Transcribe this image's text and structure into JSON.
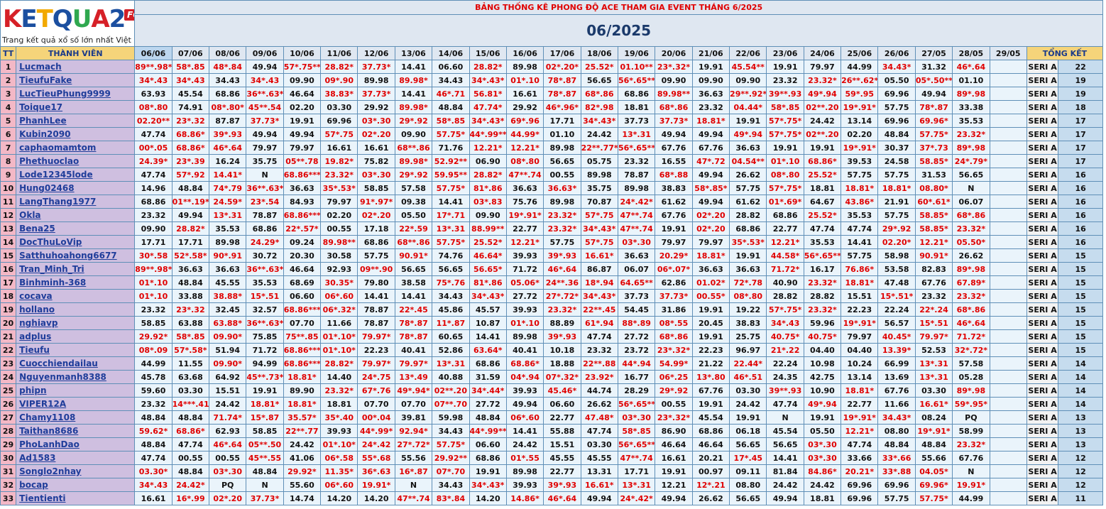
{
  "logo": {
    "word": "KETQUA2",
    "badge": "FORUM",
    "tagline": "Trang kết quả xổ số lớn nhất Việt Nam",
    "letters": [
      "K",
      "E",
      "T",
      "Q",
      "U",
      "A",
      "2"
    ],
    "letter_colors": [
      "#d62027",
      "#1b4fa0",
      "#f2a900",
      "#1b4fa0",
      "#2fa84f",
      "#d62027",
      "#1b4fa0"
    ]
  },
  "title": "BẢNG THỐNG KÊ PHONG ĐỘ ACE THAM GIA EVENT THÁNG 6/2025",
  "month": "06/2025",
  "headers": {
    "tt": "TT",
    "name": "THÀNH VIÊN",
    "total": "TỔNG KẾT",
    "dates": [
      "06/06",
      "07/06",
      "08/06",
      "09/06",
      "10/06",
      "11/06",
      "12/06",
      "13/06",
      "14/06",
      "15/06",
      "16/06",
      "17/06",
      "18/06",
      "19/06",
      "20/06",
      "21/06",
      "22/06",
      "23/06",
      "24/06",
      "25/06",
      "26/06",
      "27/05",
      "28/05",
      "29/05"
    ]
  },
  "rows": [
    {
      "tt": "1",
      "name": "Lucmach",
      "vals": [
        "89**.98*",
        "58*.85",
        "48*.84",
        "49.94",
        "57*.75**",
        "28.82*",
        "37.73*",
        "14.41",
        "06.60",
        "28.82*",
        "89.98",
        "02*.20*",
        "25.52*",
        "01.10**",
        "23*.32*",
        "19.91",
        "45.54**",
        "19.91",
        "79.97",
        "44.99",
        "34.43*",
        "31.32",
        "46*.64",
        ""
      ],
      "seri": "SERI A",
      "score": "22"
    },
    {
      "tt": "2",
      "name": "TieufuFake",
      "vals": [
        "34*.43",
        "34*.43",
        "34.43",
        "34*.43",
        "09.90",
        "09*.90",
        "89.98",
        "89.98*",
        "34.43",
        "34*.43*",
        "01*.10",
        "78*.87",
        "56.65",
        "56*.65**",
        "09.90",
        "09.90",
        "09.90",
        "23.32",
        "23.32*",
        "26**.62*",
        "05.50",
        "05*.50**",
        "01.10",
        ""
      ],
      "seri": "SERI A",
      "score": "19"
    },
    {
      "tt": "3",
      "name": "LucTieuPhung9999",
      "vals": [
        "63.93",
        "45.54",
        "68.86",
        "36**.63*",
        "46.64",
        "38.83*",
        "37.73*",
        "14.41",
        "46*.71",
        "56.81*",
        "16.61",
        "78*.87",
        "68*.86",
        "68.86",
        "89.98**",
        "36.63",
        "29**.92*",
        "39**.93",
        "49*.94",
        "59*.95",
        "69.96",
        "49.94",
        "89*.98",
        ""
      ],
      "seri": "SERI A",
      "score": "19"
    },
    {
      "tt": "4",
      "name": "Toique17",
      "vals": [
        "08*.80",
        "74.91",
        "08*.80*",
        "45**.54",
        "02.20",
        "03.30",
        "29.92",
        "89.98*",
        "48.84",
        "47.74*",
        "29.92",
        "46*.96*",
        "82*.98",
        "18.81",
        "68*.86",
        "23.32",
        "04.44*",
        "58*.85",
        "02**.20",
        "19*.91*",
        "57.75",
        "78*.87",
        "33.38",
        ""
      ],
      "seri": "SERI A",
      "score": "18"
    },
    {
      "tt": "5",
      "name": "PhanhLee",
      "vals": [
        "02.20**",
        "23*.32",
        "87.87",
        "37.73*",
        "19.91",
        "69.96",
        "03*.30",
        "29*.92",
        "58*.85",
        "34*.43*",
        "69*.96",
        "17.71",
        "34*.43*",
        "37.73",
        "37.73*",
        "18.81*",
        "19.91",
        "57*.75*",
        "24.42",
        "13.14",
        "69.96",
        "69.96*",
        "35.53",
        ""
      ],
      "seri": "SERI A",
      "score": "17"
    },
    {
      "tt": "6",
      "name": "Kubin2090",
      "vals": [
        "47.74",
        "68.86*",
        "39*.93",
        "49.94",
        "49.94",
        "57*.75",
        "02*.20",
        "09.90",
        "57.75*",
        "44*.99**",
        "44.99*",
        "01.10",
        "24.42",
        "13*.31",
        "49.94",
        "49.94",
        "49*.94",
        "57*.75*",
        "02**.20",
        "02.20",
        "48.84",
        "57.75*",
        "23.32*",
        ""
      ],
      "seri": "SERI A",
      "score": "17"
    },
    {
      "tt": "7",
      "name": "caphaomamtom",
      "vals": [
        "00*.05",
        "68.86*",
        "46*.64",
        "79.97",
        "79.97",
        "16.61",
        "16.61",
        "68**.86",
        "71.76",
        "12.21*",
        "12.21*",
        "89.98",
        "22**.77*",
        "56*.65**",
        "67.76",
        "67.76",
        "36.63",
        "19.91",
        "19.91",
        "19*.91*",
        "30.37",
        "37*.73",
        "89*.98",
        ""
      ],
      "seri": "SERI A",
      "score": "17"
    },
    {
      "tt": "8",
      "name": "Phethuoclao",
      "vals": [
        "24.39*",
        "23*.39",
        "16.24",
        "35.75",
        "05**.78",
        "19.82*",
        "75.82",
        "89.98*",
        "52.92**",
        "06.90",
        "08*.80",
        "56.65",
        "05.75",
        "23.32",
        "16.55",
        "47*.72",
        "04.54**",
        "01*.10",
        "68.86*",
        "39.53",
        "24.58",
        "58.85*",
        "24*.79*",
        ""
      ],
      "seri": "SERI A",
      "score": "17"
    },
    {
      "tt": "9",
      "name": "Lode12345lode",
      "vals": [
        "47.74",
        "57*.92",
        "14.41*",
        "N",
        "68.86***",
        "23.32*",
        "03*.30",
        "29*.92",
        "59.95**",
        "28.82*",
        "47**.74",
        "00.55",
        "89.98",
        "78.87",
        "68*.88",
        "49.94",
        "26.62",
        "08*.80",
        "25.52*",
        "57.75",
        "57.75",
        "31.53",
        "56.65",
        ""
      ],
      "seri": "SERI A",
      "score": "16"
    },
    {
      "tt": "10",
      "name": "Hung02468",
      "vals": [
        "14.96",
        "48.84",
        "74*.79",
        "36**.63*",
        "36.63",
        "35*.53*",
        "58.85",
        "57.58",
        "57.75*",
        "81*.86",
        "36.63",
        "36.63*",
        "35.75",
        "89.98",
        "38.83",
        "58*.85*",
        "57.75",
        "57*.75*",
        "18.81",
        "18.81*",
        "18.81*",
        "08.80*",
        "N",
        ""
      ],
      "seri": "SERI A",
      "score": "16"
    },
    {
      "tt": "11",
      "name": "LangThang1977",
      "vals": [
        "68.86",
        "01**.19**",
        "24.59*",
        "23*.54",
        "84.93",
        "79.97",
        "91*.97*",
        "09.38",
        "14.41",
        "03*.83",
        "75.76",
        "89.98",
        "70.87",
        "24*.42*",
        "61.62",
        "49.94",
        "61.62",
        "01*.69*",
        "64.67",
        "43.86*",
        "21.91",
        "60*.61*",
        "06.07",
        ""
      ],
      "seri": "SERI A",
      "score": "16"
    },
    {
      "tt": "12",
      "name": "Okla",
      "vals": [
        "23.32",
        "49.94",
        "13*.31",
        "78.87",
        "68.86***",
        "02.20",
        "02*.20",
        "05.50",
        "17*.71",
        "09.90",
        "19*.91*",
        "23.32*",
        "57*.75",
        "47**.74",
        "67.76",
        "02*.20",
        "28.82",
        "68.86",
        "25.52*",
        "35.53",
        "57.75",
        "58.85*",
        "68*.86",
        ""
      ],
      "seri": "SERI A",
      "score": "16"
    },
    {
      "tt": "13",
      "name": "Bena25",
      "vals": [
        "09.90",
        "28.82*",
        "35.53",
        "68.86",
        "22*.57*",
        "00.55",
        "17.18",
        "22*.59",
        "13*.31",
        "88.99**",
        "22.77",
        "23.32*",
        "34*.43*",
        "47**.74",
        "19.91",
        "02*.20",
        "68.86",
        "22.77",
        "47.74",
        "47.74",
        "29*.92",
        "58.85*",
        "23.32*",
        ""
      ],
      "seri": "SERI A",
      "score": "16"
    },
    {
      "tt": "14",
      "name": "DocThuLoVip",
      "vals": [
        "17.71",
        "17.71",
        "89.98",
        "24.29*",
        "09.24",
        "89.98**",
        "68.86",
        "68**.86",
        "57.75*",
        "25.52*",
        "12.21*",
        "57.75",
        "57*.75",
        "03*.30",
        "79.97",
        "79.97",
        "35*.53*",
        "12.21*",
        "35.53",
        "14.41",
        "02.20*",
        "12.21*",
        "05.50*",
        ""
      ],
      "seri": "SERI A",
      "score": "16"
    },
    {
      "tt": "15",
      "name": "Satthuhoahong6677",
      "vals": [
        "30*.58",
        "52*.58*",
        "90*.91",
        "30.72",
        "20.30",
        "30.58",
        "57.75",
        "90.91*",
        "74.76",
        "46.64*",
        "39.93",
        "39*.93",
        "16.61*",
        "36.63",
        "20.29*",
        "18.81*",
        "19.91",
        "44.58*",
        "56*.65**",
        "57.75",
        "58.98",
        "90.91*",
        "26.62",
        ""
      ],
      "seri": "SERI A",
      "score": "15"
    },
    {
      "tt": "16",
      "name": "Tran_Minh_Tri",
      "vals": [
        "89**.98*",
        "36.63",
        "36.63",
        "36**.63*",
        "46.64",
        "92.93",
        "09**.90",
        "56.65",
        "56.65",
        "56.65*",
        "71.72",
        "46*.64",
        "86.87",
        "06.07",
        "06*.07*",
        "36.63",
        "36.63",
        "71.72*",
        "16.17",
        "76.86*",
        "53.58",
        "82.83",
        "89*.98",
        ""
      ],
      "seri": "SERI A",
      "score": "15"
    },
    {
      "tt": "17",
      "name": "Binhminh-368",
      "vals": [
        "01*.10",
        "48.84",
        "45.55",
        "35.53",
        "68.69",
        "30.35*",
        "79.80",
        "38.58",
        "75*.76",
        "81*.86",
        "05.06*",
        "24**.36",
        "18*.94",
        "64.65**",
        "62.86",
        "01.02*",
        "72*.78",
        "40.90",
        "23.32*",
        "18.81*",
        "47.48",
        "67.76",
        "67.89*",
        ""
      ],
      "seri": "SERI A",
      "score": "15"
    },
    {
      "tt": "18",
      "name": "cocava",
      "vals": [
        "01*.10",
        "33.88",
        "38.88*",
        "15*.51",
        "06.60",
        "06*.60",
        "14.41",
        "14.41",
        "34.43",
        "34*.43*",
        "27.72",
        "27*.72*",
        "34*.43*",
        "37.73",
        "37.73*",
        "00.55*",
        "08*.80",
        "28.82",
        "28.82",
        "15.51",
        "15*.51*",
        "23.32",
        "23.32*",
        ""
      ],
      "seri": "SERI A",
      "score": "15"
    },
    {
      "tt": "19",
      "name": "hollano",
      "vals": [
        "23.32",
        "23*.32",
        "32.45",
        "32.57",
        "68.86***",
        "06*.32*",
        "78.87",
        "22*.45",
        "45.86",
        "45.57",
        "39.93",
        "23.32*",
        "22**.45",
        "54.45",
        "31.86",
        "19.91",
        "19.22",
        "57*.75*",
        "23.32*",
        "22.23",
        "22.24",
        "22*.24",
        "68*.86",
        ""
      ],
      "seri": "SERI A",
      "score": "15"
    },
    {
      "tt": "20",
      "name": "nghiavp",
      "vals": [
        "58.85",
        "63.88",
        "63.88*",
        "36**.63*",
        "07.70",
        "11.66",
        "78.87",
        "78*.87",
        "11*.87",
        "10.87",
        "01*.10",
        "88.89",
        "61*.94",
        "88*.89",
        "08*.55",
        "20.45",
        "38.83",
        "34*.43",
        "59.96",
        "19*.91*",
        "56.57",
        "15*.51",
        "46*.64",
        ""
      ],
      "seri": "SERI A",
      "score": "15"
    },
    {
      "tt": "21",
      "name": "adplus",
      "vals": [
        "29.92*",
        "58*.85",
        "09.90*",
        "75.85",
        "75**.85",
        "01*.10*",
        "79.97*",
        "78*.87",
        "60.65",
        "14.41",
        "89.98",
        "39*.93",
        "47.74",
        "27.72",
        "68*.86",
        "19.91",
        "25.75",
        "40.75*",
        "40.75*",
        "79.97",
        "40.45*",
        "79.97*",
        "71.72*",
        ""
      ],
      "seri": "SERI A",
      "score": "15"
    },
    {
      "tt": "22",
      "name": "Tieufu",
      "vals": [
        "08*.09",
        "57*.58*",
        "51.94",
        "71.72",
        "68.86***",
        "01*.10*",
        "22.23",
        "40.41",
        "52.86",
        "63.64*",
        "40.41",
        "10.18",
        "23.32",
        "23.72",
        "23*.32*",
        "22.23",
        "96.97",
        "21*.22",
        "04.40",
        "04.40",
        "13.39*",
        "52.53",
        "32*.72*",
        ""
      ],
      "seri": "SERI A",
      "score": "15"
    },
    {
      "tt": "23",
      "name": "Cuocchiendailau",
      "vals": [
        "44.99",
        "11.55",
        "09.90*",
        "94.99",
        "68.86***",
        "28.82*",
        "79.97*",
        "79.97*",
        "13*.31",
        "68.86",
        "68.86*",
        "18.88",
        "22**.88",
        "44*.94",
        "54.99*",
        "21.22",
        "22.44*",
        "22.24",
        "10.98",
        "10.24",
        "66.99",
        "13*.31",
        "57.58",
        ""
      ],
      "seri": "SERI A",
      "score": "14"
    },
    {
      "tt": "24",
      "name": "Nguyenmanh8388",
      "vals": [
        "45.78",
        "63.68",
        "64.92",
        "45**.73*",
        "18.81*",
        "14.40",
        "24*.75",
        "13*.49",
        "40.88",
        "31.59",
        "04*.94",
        "07*.32*",
        "23.92*",
        "16.77",
        "06*.25",
        "13*.80",
        "46*.51",
        "24.35",
        "42.75",
        "13.14",
        "13.69",
        "13*.31",
        "05.28",
        ""
      ],
      "seri": "SERI A",
      "score": "14"
    },
    {
      "tt": "25",
      "name": "phipn",
      "vals": [
        "59.60",
        "03.30",
        "15.51",
        "19.91",
        "89.90",
        "23.32*",
        "67*.76",
        "49*.94*",
        "02**.20",
        "34*.44*",
        "39.93",
        "45.46*",
        "44.74",
        "28.29",
        "29*.92",
        "67.76",
        "03.30",
        "39**.93",
        "10.90",
        "18.81*",
        "67.76",
        "03.30",
        "89*.98",
        ""
      ],
      "seri": "SERI A",
      "score": "14"
    },
    {
      "tt": "26",
      "name": "VIPER12A",
      "vals": [
        "23.32",
        "14***.41",
        "24.42",
        "18.81*",
        "18.81*",
        "18.81",
        "07.70",
        "07.70",
        "07**.70",
        "27.72",
        "49.94",
        "06.60",
        "26.62",
        "56*.65**",
        "00.55",
        "19.91",
        "24.42",
        "47.74",
        "49*.94",
        "22.77",
        "11.66",
        "16.61*",
        "59*.95*",
        ""
      ],
      "seri": "SERI A",
      "score": "14"
    },
    {
      "tt": "27",
      "name": "Chamy1108",
      "vals": [
        "48.84",
        "48.84",
        "71.74*",
        "15*.87",
        "35.57*",
        "35*.40",
        "00*.04",
        "39.81",
        "59.98",
        "48.84",
        "06*.60",
        "22.77",
        "47.48*",
        "03*.30",
        "23*.32*",
        "45.54",
        "19.91",
        "N",
        "19.91",
        "19*.91*",
        "34.43*",
        "08.24",
        "PQ",
        ""
      ],
      "seri": "SERI A",
      "score": "13"
    },
    {
      "tt": "28",
      "name": "Taithan8686",
      "vals": [
        "59.62*",
        "68.86*",
        "62.93",
        "58.85",
        "22**.77",
        "39.93",
        "44*.99*",
        "92.94*",
        "34.43",
        "44*.99**",
        "14.41",
        "55.88",
        "47.74",
        "58*.85",
        "86.90",
        "68.86",
        "06.18",
        "45.54",
        "05.50",
        "12.21*",
        "08.80",
        "19*.91*",
        "58.99",
        ""
      ],
      "seri": "SERI A",
      "score": "13"
    },
    {
      "tt": "29",
      "name": "PhoLanhDao",
      "vals": [
        "48.84",
        "47.74",
        "46*.64",
        "05**.50",
        "24.42",
        "01*.10*",
        "24*.42",
        "27*.72*",
        "57.75*",
        "06.60",
        "24.42",
        "15.51",
        "03.30",
        "56*.65**",
        "46.64",
        "46.64",
        "56.65",
        "56.65",
        "03*.30",
        "47.74",
        "48.84",
        "48.84",
        "23.32*",
        ""
      ],
      "seri": "SERI A",
      "score": "13"
    },
    {
      "tt": "30",
      "name": "Ad1583",
      "vals": [
        "47.74",
        "00.55",
        "00.55",
        "45**.55",
        "41.06",
        "06*.58",
        "55*.68",
        "55.56",
        "29.92**",
        "68.86",
        "01*.55",
        "45.55",
        "45.55",
        "47**.74",
        "16.61",
        "20.21",
        "17*.45",
        "14.41",
        "03*.30",
        "33.66",
        "33*.66",
        "55.66",
        "67.76",
        ""
      ],
      "seri": "SERI A",
      "score": "12"
    },
    {
      "tt": "31",
      "name": "Songlo2nhay",
      "vals": [
        "03.30*",
        "48.84",
        "03*.30",
        "48.84",
        "29.92*",
        "11.35*",
        "36*.63",
        "16*.87",
        "07*.70",
        "19.91",
        "89.98",
        "22.77",
        "13.31",
        "17.71",
        "19.91",
        "00.97",
        "09.11",
        "81.84",
        "84.86*",
        "20.21*",
        "33*.88",
        "04.05*",
        "N",
        ""
      ],
      "seri": "SERI A",
      "score": "12"
    },
    {
      "tt": "32",
      "name": "bocap",
      "vals": [
        "34*.43",
        "24.42*",
        "PQ",
        "N",
        "55.60",
        "06*.60",
        "19.91*",
        "N",
        "34.43",
        "34*.43*",
        "39.93",
        "39*.93",
        "16.61*",
        "13*.31",
        "12.21",
        "12*.21",
        "08.80",
        "24.42",
        "24.42",
        "69.96",
        "69.96",
        "69.96*",
        "19.91*",
        ""
      ],
      "seri": "SERI A",
      "score": "12"
    },
    {
      "tt": "33",
      "name": "Tientienti",
      "vals": [
        "16.61",
        "16*.99",
        "02*.20",
        "37.73*",
        "14.74",
        "14.20",
        "14.20",
        "47**.74",
        "83*.84",
        "14.20",
        "14.86*",
        "46*.64",
        "49.94",
        "24*.42*",
        "49.94",
        "26.62",
        "56.65",
        "49.94",
        "18.81",
        "69.96",
        "57.75",
        "57.75*",
        "44.99",
        ""
      ],
      "seri": "SERI A",
      "score": "11"
    }
  ],
  "colors": {
    "border": "#5f8fb7",
    "value_bg": "#eaf4fb",
    "name_bg": "#cfbfe0",
    "tt_bg": "#f3b8c6",
    "hot": "#e00000",
    "seri": "#19b319",
    "header_bg": "#dfe7f1",
    "accent_header": "#f5d47a"
  }
}
